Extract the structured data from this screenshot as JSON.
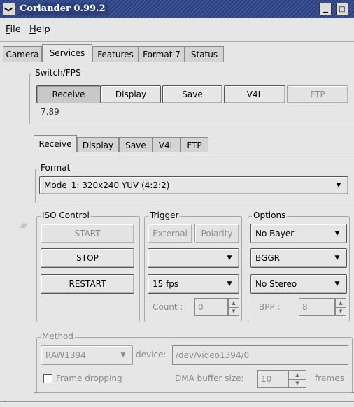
{
  "window": {
    "title": "Coriander 0.99.2",
    "menu_glyph": "❯",
    "min_glyph": "▁",
    "max_glyph": "□"
  },
  "menu": [
    {
      "key": "F",
      "rest": "ile"
    },
    {
      "key": "H",
      "rest": "elp"
    }
  ],
  "main_tabs": [
    "Camera",
    "Services",
    "Features",
    "Format 7",
    "Status"
  ],
  "switch_fps": {
    "label": "Switch/FPS",
    "buttons": [
      "Receive",
      "Display",
      "Save",
      "V4L",
      "FTP"
    ],
    "fps": "7.89"
  },
  "sub_tabs": [
    "Receive",
    "Display",
    "Save",
    "V4L",
    "FTP"
  ],
  "format": {
    "label": "Format",
    "value": "Mode_1: 320x240 YUV (4:2:2)"
  },
  "iso_control": {
    "label": "ISO Control",
    "buttons": [
      "START",
      "STOP",
      "RESTART"
    ]
  },
  "trigger": {
    "label": "Trigger",
    "external": "External",
    "polarity": "Polarity",
    "mode_value": "",
    "fps_value": "15 fps",
    "count_label": "Count :",
    "count_value": "0"
  },
  "options": {
    "label": "Options",
    "bayer": "No Bayer",
    "pattern": "BGGR",
    "stereo": "No Stereo",
    "bpp_label": "BPP :",
    "bpp_value": "8"
  },
  "method": {
    "label": "Method",
    "value": "RAW1394",
    "device_label": "device:",
    "device_value": "/dev/video1394/0",
    "frame_dropping": "Frame dropping",
    "dma_label": "DMA buffer size:",
    "dma_value": "10",
    "dma_unit": "frames"
  },
  "glyphs": {
    "down": "▼",
    "up": "▲",
    "grip": "⁄⁄⁄⁄⁄"
  }
}
